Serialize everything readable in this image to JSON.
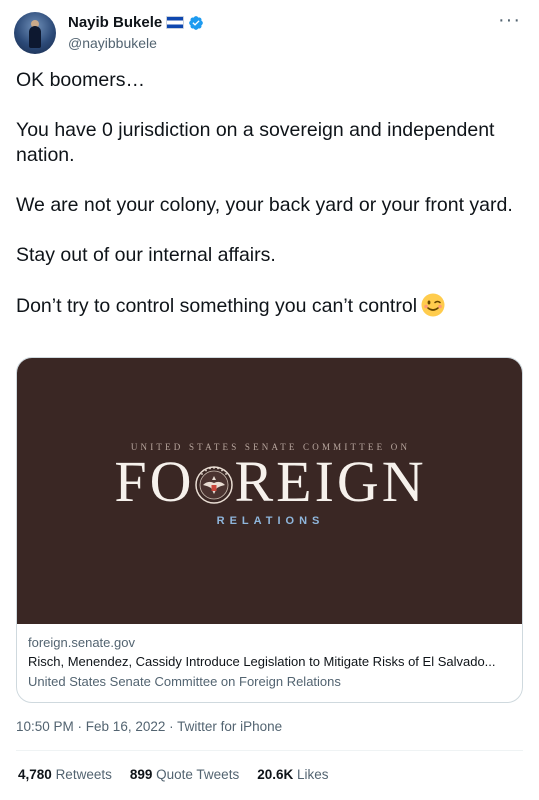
{
  "author": {
    "display_name": "Nayib Bukele",
    "handle": "@nayibbukele"
  },
  "tweet": {
    "paragraphs": [
      "OK boomers…",
      "You have 0 jurisdiction on a sovereign and independent nation.",
      "We are not your colony, your back yard or your front yard.",
      "Stay out of our internal affairs.",
      "Don’t try to control something you can’t control"
    ],
    "emoji_icon": "winking-face-icon"
  },
  "card": {
    "image": {
      "org_line": "UNITED STATES SENATE COMMITTEE ON",
      "word_left": "FO",
      "word_right": "REIGN",
      "word_bottom": "RELATIONS"
    },
    "domain": "foreign.senate.gov",
    "title": "Risch, Menendez, Cassidy Introduce Legislation to Mitigate Risks of El Salvado...",
    "description": "United States Senate Committee on Foreign Relations"
  },
  "meta": {
    "time": "10:50 PM",
    "separator": " · ",
    "date": "Feb 16, 2022",
    "source": "Twitter for iPhone"
  },
  "stats": {
    "retweets_count": "4,780",
    "retweets_label": "Retweets",
    "quotes_count": "899",
    "quotes_label": "Quote Tweets",
    "likes_count": "20.6K",
    "likes_label": "Likes"
  },
  "icons": {
    "verified": "verified-badge-icon",
    "flag": "el-salvador-flag-icon",
    "more": "more-options-icon"
  },
  "colors": {
    "verified": "#1d9bf0",
    "card_bg": "#3a2724",
    "relations_text": "#8fb6dc",
    "secondary_text": "#536471"
  }
}
